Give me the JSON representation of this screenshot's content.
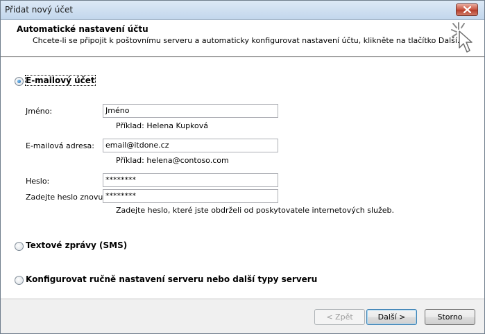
{
  "window": {
    "title": "Přidat nový účet"
  },
  "header": {
    "title": "Automatické nastavení účtu",
    "subtitle": "Chcete-li se připojit k poštovnímu serveru a automaticky konfigurovat nastavení účtu, klikněte na tlačítko Další."
  },
  "options": {
    "email": {
      "label": "E-mailový účet",
      "selected": true
    },
    "sms": {
      "label": "Textové zprávy (SMS)",
      "selected": false
    },
    "manual": {
      "label": "Konfigurovat ručně nastavení serveru nebo další typy serveru",
      "selected": false
    }
  },
  "form": {
    "name": {
      "label": "Jméno:",
      "value": "Jméno",
      "hint": "Příklad: Helena Kupková"
    },
    "email": {
      "label": "E-mailová adresa:",
      "value": "email@itdone.cz",
      "hint": "Příklad: helena@contoso.com"
    },
    "password": {
      "label": "Heslo:",
      "value": "********"
    },
    "password_confirm": {
      "label": "Zadejte heslo znovu:",
      "value": "********",
      "hint": "Zadejte heslo, které jste obdrželi od poskytovatele internetových služeb."
    }
  },
  "buttons": {
    "back": "< Zpět",
    "next": "Další >",
    "cancel": "Storno"
  }
}
